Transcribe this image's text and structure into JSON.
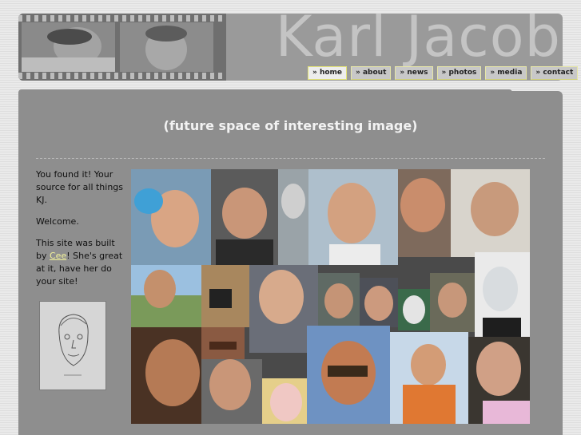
{
  "header": {
    "site_title": "Karl Jacob"
  },
  "nav": {
    "items": [
      {
        "label": "» home",
        "active": true
      },
      {
        "label": "» about",
        "active": false
      },
      {
        "label": "» news",
        "active": false
      },
      {
        "label": "» photos",
        "active": false
      },
      {
        "label": "» media",
        "active": false
      },
      {
        "label": "» contact",
        "active": false
      }
    ]
  },
  "main": {
    "image_placeholder": "(future space of interesting image)"
  },
  "sidebar": {
    "intro": "You found it! Your source for all things KJ.",
    "welcome": "Welcome.",
    "credit_prefix": "This site was built by ",
    "credit_link": "Cee",
    "credit_suffix": "! She's great at it, have her do your site!"
  },
  "colors": {
    "link": "#f2f29a",
    "main_bg": "#8e8e8e",
    "header_bg": "#9a9a9a",
    "nav_active": "#ededed"
  }
}
